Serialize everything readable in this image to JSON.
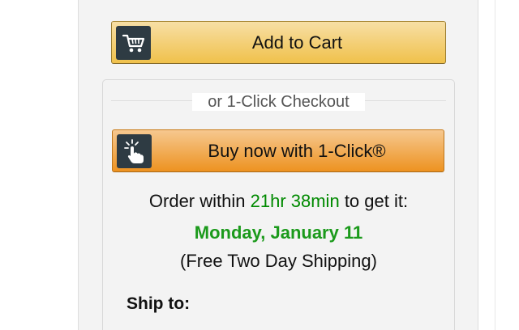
{
  "add_to_cart": {
    "label": "Add to Cart",
    "icon": "cart-icon"
  },
  "checkout": {
    "divider_text": "or 1-Click Checkout",
    "buy_now_label": "Buy now with 1-Click®",
    "buy_now_icon": "tap-hand-icon"
  },
  "delivery": {
    "order_prefix": "Order within",
    "countdown": "21hr 38min",
    "order_suffix": "to get it:",
    "date": "Monday, January 11",
    "shipping_note": "(Free Two Day Shipping)"
  },
  "ship_to": {
    "label": "Ship to:"
  },
  "colors": {
    "accent_green": "#008a00",
    "cart_button": "#f0c14b",
    "buy_button": "#ed9220",
    "icon_bg": "#2e3b43"
  }
}
